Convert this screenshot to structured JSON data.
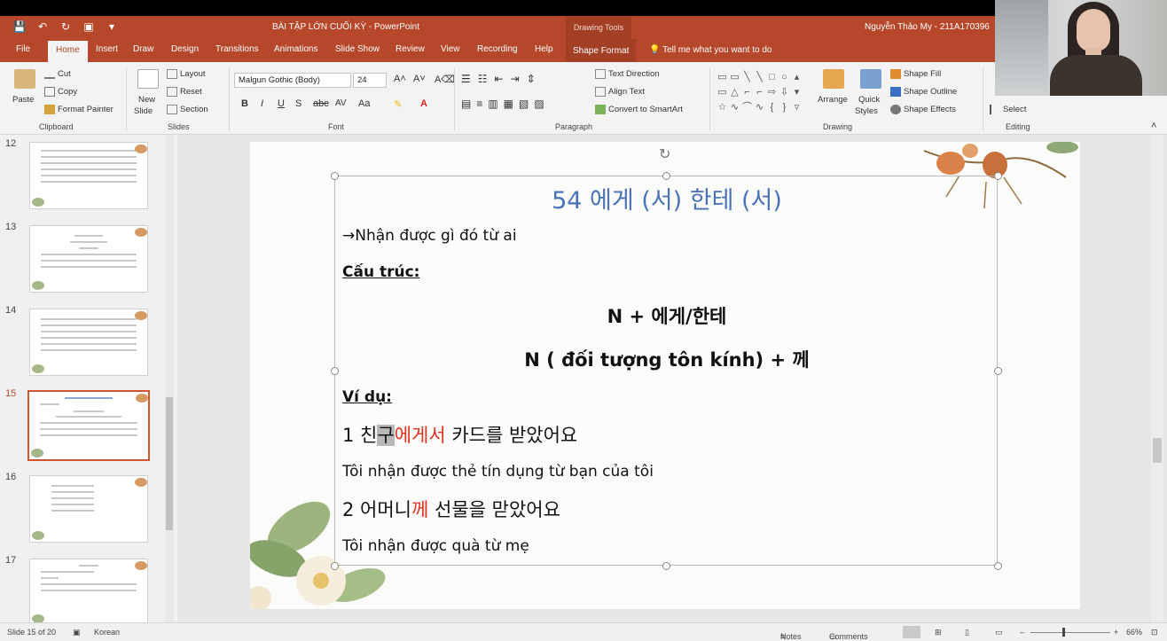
{
  "titlebar": {
    "qat": [
      "💾",
      "↶",
      "↻",
      "▣",
      "▾"
    ],
    "doc_title": "BÀI TẬP LỚN CUỐI KỲ  -  PowerPoint",
    "context_tab": "Drawing Tools",
    "user": "Nguyễn Thảo My - 211A170396"
  },
  "tabs": {
    "file": "File",
    "home": "Home",
    "insert": "Insert",
    "draw": "Draw",
    "design": "Design",
    "transitions": "Transitions",
    "animations": "Animations",
    "slideshow": "Slide Show",
    "review": "Review",
    "view": "View",
    "recording": "Recording",
    "help": "Help",
    "shape_format": "Shape Format",
    "tell_me": "Tell me what you want to do"
  },
  "ribbon": {
    "clipboard": {
      "paste": "Paste",
      "cut": "Cut",
      "copy": "Copy",
      "format_painter": "Format Painter",
      "label": "Clipboard"
    },
    "slides": {
      "new_slide": "New",
      "new_slide2": "Slide",
      "layout": "Layout",
      "reset": "Reset",
      "section": "Section",
      "label": "Slides"
    },
    "font": {
      "name": "Malgun Gothic (Body)",
      "size": "24",
      "label": "Font"
    },
    "paragraph": {
      "text_direction": "Text Direction",
      "align_text": "Align Text",
      "smartart": "Convert to SmartArt",
      "label": "Paragraph"
    },
    "drawing": {
      "arrange": "Arrange",
      "quick_styles": "Quick",
      "quick_styles2": "Styles",
      "shape_fill": "Shape Fill",
      "shape_outline": "Shape Outline",
      "shape_effects": "Shape Effects",
      "label": "Drawing"
    },
    "editing": {
      "select": "Select",
      "label": "Editing"
    }
  },
  "thumbnails": [
    {
      "num": "12"
    },
    {
      "num": "13"
    },
    {
      "num": "14"
    },
    {
      "num": "15"
    },
    {
      "num": "16"
    },
    {
      "num": "17"
    }
  ],
  "slide": {
    "title": "54 에게 (서) 한테 (서)",
    "line1": "→Nhận được gì đó từ ai",
    "structure": "Cấu trúc:",
    "formula1": "N + 에게/한테",
    "formula2": "N ( đối tượng tôn kính) + 께",
    "example_label": "Ví dụ:",
    "ex1_prefix": "1 친",
    "ex1_highlight": "구",
    "ex1_red": "에게서",
    "ex1_rest": " 카드를 받았어요",
    "ex1_trans": "Tôi nhận được thẻ tín dụng từ bạn của tôi",
    "ex2_prefix": "2 어머니",
    "ex2_red": "께",
    "ex2_rest": " 선물을 맏았어요",
    "ex2_trans": "Tôi nhận được quà từ mẹ"
  },
  "status": {
    "slide_count": "Slide 15 of 20",
    "language": "Korean",
    "notes": "Notes",
    "comments": "Comments",
    "zoom": "66%"
  },
  "colors": {
    "accent": "#b7472a",
    "title_blue": "#4a72b8",
    "red": "#e0301e"
  }
}
